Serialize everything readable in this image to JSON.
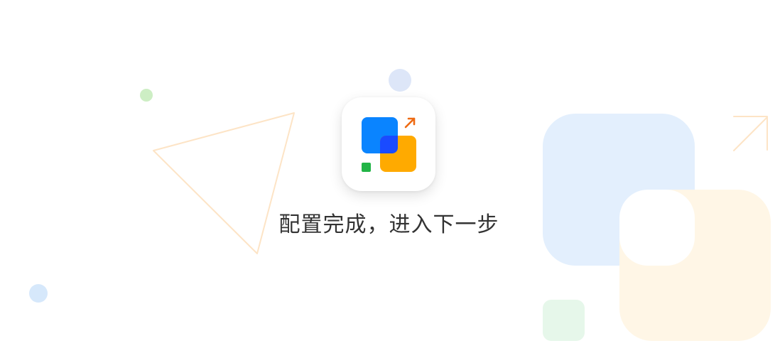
{
  "message": "配置完成，进入下一步",
  "icon": "app-config-complete-icon",
  "colors": {
    "background": "#ffffff",
    "text": "#333333",
    "icon_blue": "#0a84ff",
    "icon_blue_overlap": "#1a4bff",
    "icon_orange": "#ffaa00",
    "icon_green": "#22b446",
    "icon_arrow": "#ee6a12",
    "deco_blue": "#e3effd",
    "deco_orange": "#fff6e6",
    "deco_green": "#e6f7ea",
    "deco_triangle": "#fde4c6",
    "deco_dot_green": "#cdeec4",
    "deco_dot_blue": "#d6e8fb",
    "deco_dot_lavender": "#dde6f8"
  }
}
